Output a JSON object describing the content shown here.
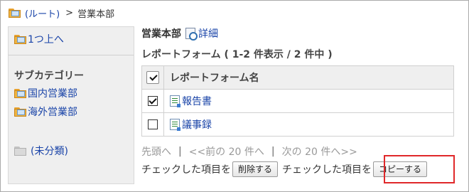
{
  "breadcrumb": {
    "root_label": "(ルート)",
    "separator": ">",
    "current": "営業本部"
  },
  "sidebar": {
    "up_label": "1つ上へ",
    "subcategory_heading": "サブカテゴリー",
    "subcategories": [
      "国内営業部",
      "海外営業部"
    ],
    "uncategorized_label": "(未分類)"
  },
  "main": {
    "category_name": "営業本部",
    "detail_link": "詳細",
    "subtitle": "レポートフォーム ( 1-2 件表示 / 2 件中 )",
    "table": {
      "header_name": "レポートフォーム名",
      "rows": [
        {
          "name": "報告書",
          "checked": true
        },
        {
          "name": "議事録",
          "checked": false
        }
      ]
    },
    "pager": {
      "first": "先頭へ",
      "separator": "|",
      "prev": "<<前の 20 件へ",
      "next": "次の 20 件へ>>"
    },
    "actions": {
      "checked_items_label_1": "チェックした項目を",
      "delete_button": "削除する",
      "checked_items_label_2": "チェックした項目を",
      "copy_button": "コピーする"
    }
  },
  "colors": {
    "link": "#1a44a8",
    "highlight": "#e0282a",
    "sidebar_bg": "#efefef"
  }
}
